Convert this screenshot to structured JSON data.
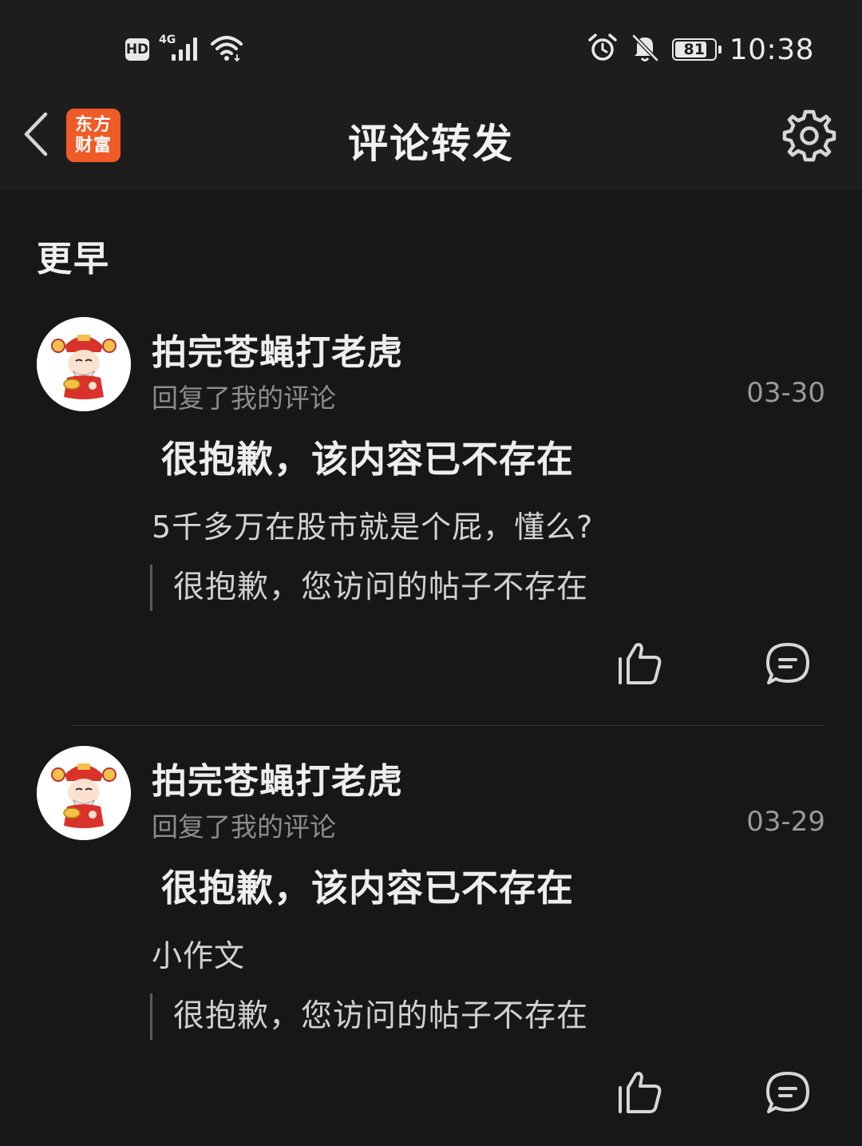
{
  "status_bar": {
    "hd": "HD",
    "network": "4G",
    "signal_bars": 4,
    "battery": "81",
    "battery_level": 0.81,
    "time": "10:38"
  },
  "header": {
    "logo_line1": "东方",
    "logo_line2": "财富",
    "title": "评论转发"
  },
  "section_title": "更早",
  "items": [
    {
      "username": "拍完苍蝇打老虎",
      "action": "回复了我的评论",
      "date": "03-30",
      "deleted_notice": "很抱歉，该内容已不存在",
      "text": "5千多万在股市就是个屁，懂么?",
      "quote": "很抱歉，您访问的帖子不存在"
    },
    {
      "username": "拍完苍蝇打老虎",
      "action": "回复了我的评论",
      "date": "03-29",
      "deleted_notice": "很抱歉，该内容已不存在",
      "text": "小作文",
      "quote": "很抱歉，您访问的帖子不存在"
    }
  ],
  "icons": {
    "back": "chevron-left-icon",
    "settings": "gear-icon",
    "like": "thumbs-up-icon",
    "comment": "comment-bubble-icon",
    "alarm": "alarm-clock-icon",
    "mute": "bell-off-icon",
    "wifi": "wifi-icon"
  },
  "colors": {
    "background": "#171717",
    "header_bg": "#1d1d1d",
    "logo": "#f05a26",
    "avatar_hat": "#d9322b"
  }
}
